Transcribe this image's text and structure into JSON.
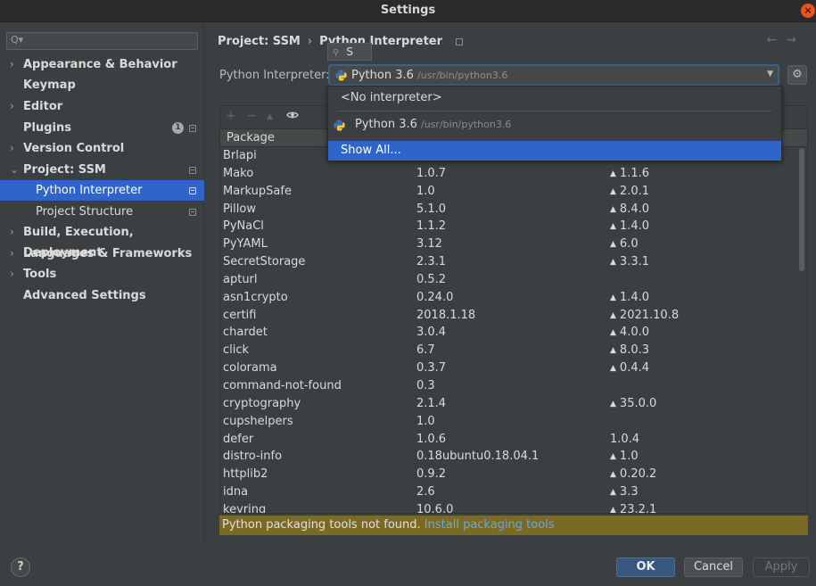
{
  "window": {
    "title": "Settings"
  },
  "sidebar": {
    "search_placeholder": "",
    "items": [
      {
        "label": "Appearance & Behavior",
        "arrow": "›"
      },
      {
        "label": "Keymap",
        "arrow": ""
      },
      {
        "label": "Editor",
        "arrow": "›"
      },
      {
        "label": "Plugins",
        "arrow": "",
        "badge": "1"
      },
      {
        "label": "Version Control",
        "arrow": "›"
      },
      {
        "label": "Project: SSM",
        "arrow": "⌄"
      },
      {
        "label": "Python Interpreter",
        "arrow": ""
      },
      {
        "label": "Project Structure",
        "arrow": ""
      },
      {
        "label": "Build, Execution, Deployment",
        "arrow": "›"
      },
      {
        "label": "Languages & Frameworks",
        "arrow": "›"
      },
      {
        "label": "Tools",
        "arrow": "›"
      },
      {
        "label": "Advanced Settings",
        "arrow": ""
      }
    ]
  },
  "breadcrumb": {
    "project": "Project: SSM",
    "separator": "›",
    "page": "Python Interpreter"
  },
  "interpreter": {
    "label": "Python Interpreter:",
    "selected_name": "Python 3.6",
    "selected_path": "/usr/bin/python3.6",
    "speed_search": "S"
  },
  "popup": {
    "no_interpreter": "<No interpreter>",
    "option_name": "Python 3.6",
    "option_path": "/usr/bin/python3.6",
    "show_all": "Show All..."
  },
  "table": {
    "headers": {
      "package": "Package"
    },
    "rows": [
      {
        "name": "Brlapi",
        "version": "",
        "latest": "",
        "up": false
      },
      {
        "name": "Mako",
        "version": "1.0.7",
        "latest": "1.1.6",
        "up": true
      },
      {
        "name": "MarkupSafe",
        "version": "1.0",
        "latest": "2.0.1",
        "up": true
      },
      {
        "name": "Pillow",
        "version": "5.1.0",
        "latest": "8.4.0",
        "up": true
      },
      {
        "name": "PyNaCl",
        "version": "1.1.2",
        "latest": "1.4.0",
        "up": true
      },
      {
        "name": "PyYAML",
        "version": "3.12",
        "latest": "6.0",
        "up": true
      },
      {
        "name": "SecretStorage",
        "version": "2.3.1",
        "latest": "3.3.1",
        "up": true
      },
      {
        "name": "apturl",
        "version": "0.5.2",
        "latest": "",
        "up": false
      },
      {
        "name": "asn1crypto",
        "version": "0.24.0",
        "latest": "1.4.0",
        "up": true
      },
      {
        "name": "certifi",
        "version": "2018.1.18",
        "latest": "2021.10.8",
        "up": true
      },
      {
        "name": "chardet",
        "version": "3.0.4",
        "latest": "4.0.0",
        "up": true
      },
      {
        "name": "click",
        "version": "6.7",
        "latest": "8.0.3",
        "up": true
      },
      {
        "name": "colorama",
        "version": "0.3.7",
        "latest": "0.4.4",
        "up": true
      },
      {
        "name": "command-not-found",
        "version": "0.3",
        "latest": "",
        "up": false
      },
      {
        "name": "cryptography",
        "version": "2.1.4",
        "latest": "35.0.0",
        "up": true
      },
      {
        "name": "cupshelpers",
        "version": "1.0",
        "latest": "",
        "up": false
      },
      {
        "name": "defer",
        "version": "1.0.6",
        "latest": "1.0.4",
        "up": false
      },
      {
        "name": "distro-info",
        "version": "0.18ubuntu0.18.04.1",
        "latest": "1.0",
        "up": true
      },
      {
        "name": "httplib2",
        "version": "0.9.2",
        "latest": "0.20.2",
        "up": true
      },
      {
        "name": "idna",
        "version": "2.6",
        "latest": "3.3",
        "up": true
      },
      {
        "name": "keyring",
        "version": "10.6.0",
        "latest": "23.2.1",
        "up": true
      }
    ]
  },
  "warning": {
    "text": "Python packaging tools not found.",
    "link": "Install packaging tools"
  },
  "buttons": {
    "help": "?",
    "ok": "OK",
    "cancel": "Cancel",
    "apply": "Apply"
  },
  "icons": {
    "add": "+",
    "remove": "−",
    "upgrade": "▲",
    "eye": "👁",
    "gear": "⚙",
    "close": "×",
    "search": "⚲",
    "up_arrow": "▲",
    "back": "←",
    "forward": "→",
    "dropdown": "▼"
  }
}
